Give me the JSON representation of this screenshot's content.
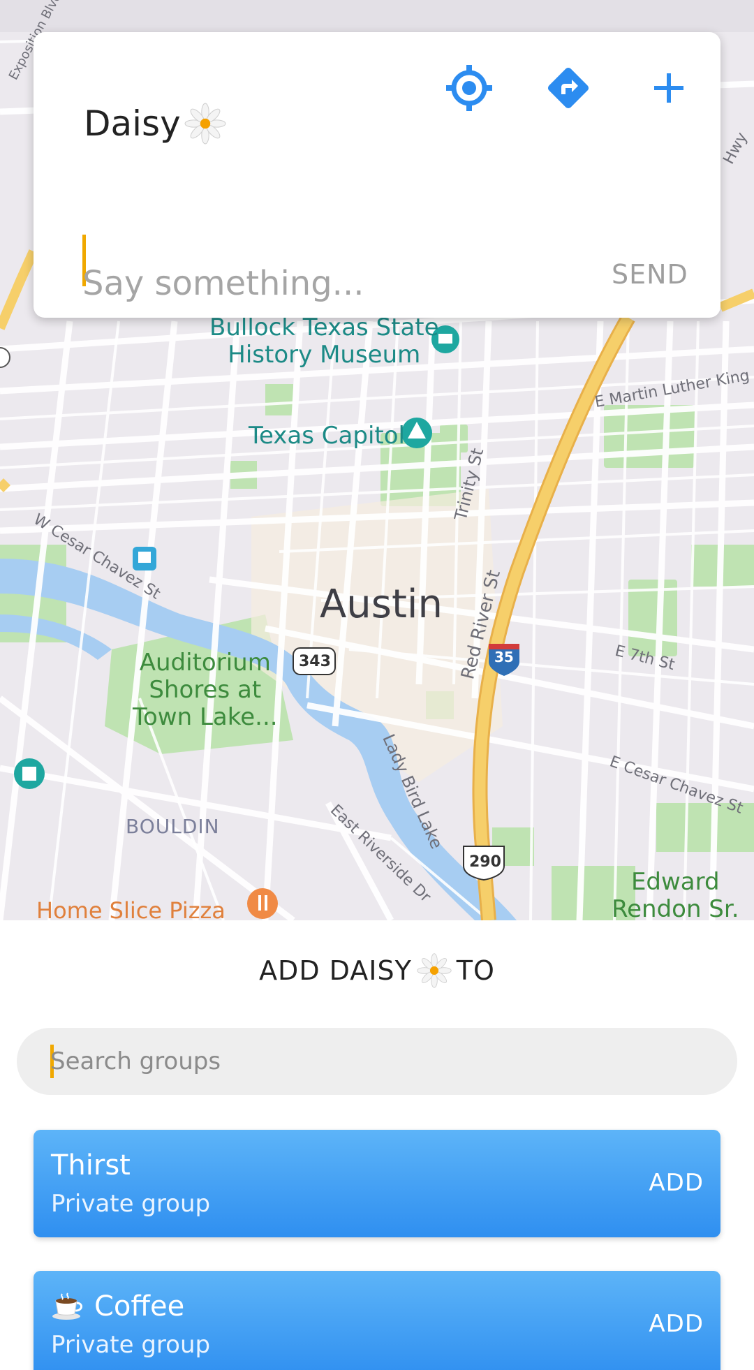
{
  "card": {
    "title": "Daisy",
    "title_emoji": "daisy-flower-icon",
    "message_placeholder": "Say something...",
    "send_label": "SEND",
    "icons": [
      "crosshair-locate-icon",
      "directions-icon",
      "plus-icon"
    ]
  },
  "map": {
    "city_label": "Austin",
    "pois": {
      "bullock_line1": "Bullock Texas State",
      "bullock_line2": "History Museum",
      "capitol": "Texas Capitol",
      "auditorium_line1": "Auditorium",
      "auditorium_line2": "Shores at",
      "auditorium_line3": "Town Lake...",
      "edward_line1": "Edward",
      "edward_line2": "Rendon Sr.",
      "home_slice": "Home Slice Pizza",
      "bouldin": "BOULDIN"
    },
    "streets": {
      "mlk": "E Martin Luther King Jr Blvd",
      "trinity": "Trinity St",
      "red_river": "Red River St",
      "e7th": "E 7th St",
      "cesar_chavez_w": "W Cesar Chavez St",
      "cesar_chavez_e": "E Cesar Chavez St",
      "lady_bird": "Lady Bird Lake",
      "riverside": "East Riverside Dr",
      "exposition": "Exposition Blvd",
      "hwy": "Hwy"
    },
    "shields": {
      "interstate": "35",
      "hwy343": "343",
      "us290": "290"
    },
    "colors": {
      "land": "#ece9ee",
      "water": "#a7cdf2",
      "park": "#bfe3b2",
      "highway": "#f6cf6a",
      "road": "#ffffff",
      "accent": "#2c8cf0"
    }
  },
  "panel": {
    "title_prefix": "ADD DAISY",
    "title_suffix": "TO",
    "search_placeholder": "Search groups",
    "groups": [
      {
        "name": "Thirst",
        "type": "Private group",
        "action": "ADD",
        "icon": ""
      },
      {
        "name": "Coffee",
        "type": "Private group",
        "action": "ADD",
        "icon": "coffee-cup-icon"
      }
    ]
  }
}
